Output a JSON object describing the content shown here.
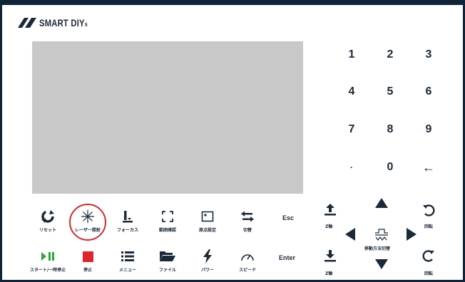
{
  "header": {
    "brand": "SMART DIY",
    "brand_suffix": "s"
  },
  "screen": {
    "color": "#c8c8c8"
  },
  "numpad": {
    "keys": [
      "1",
      "2",
      "3",
      "4",
      "5",
      "6",
      "7",
      "8",
      "9",
      "·",
      "0",
      "←"
    ]
  },
  "controls": {
    "row1": [
      {
        "label": "リセット",
        "icon": "reset-icon"
      },
      {
        "label": "レーザー照射",
        "icon": "laser-icon"
      },
      {
        "label": "フォーカス",
        "icon": "focus-icon"
      },
      {
        "label": "範囲確認",
        "icon": "frame-icon"
      },
      {
        "label": "原点設定",
        "icon": "origin-icon"
      },
      {
        "label": "切替",
        "icon": "switch-icon"
      }
    ],
    "row2": [
      {
        "label": "スタート/一時停止",
        "icon": "play-pause-icon"
      },
      {
        "label": "停止",
        "icon": "stop-icon"
      },
      {
        "label": "メニュー",
        "icon": "menu-icon"
      },
      {
        "label": "ファイル",
        "icon": "folder-icon"
      },
      {
        "label": "パワー",
        "icon": "power-icon"
      },
      {
        "label": "スピード",
        "icon": "speed-icon"
      }
    ],
    "esc": "Esc",
    "enter": "Enter"
  },
  "motion": {
    "z_up_label": "Z軸",
    "z_down_label": "Z軸",
    "mode_label": "移動方法切替",
    "rotate_ccw_label": "回転",
    "rotate_cw_label": "回転"
  },
  "colors": {
    "frame": "#0f2438",
    "text": "#1b2a3a",
    "play": "#2aa63a",
    "stop": "#e0242c",
    "highlight": "#d7262b"
  }
}
